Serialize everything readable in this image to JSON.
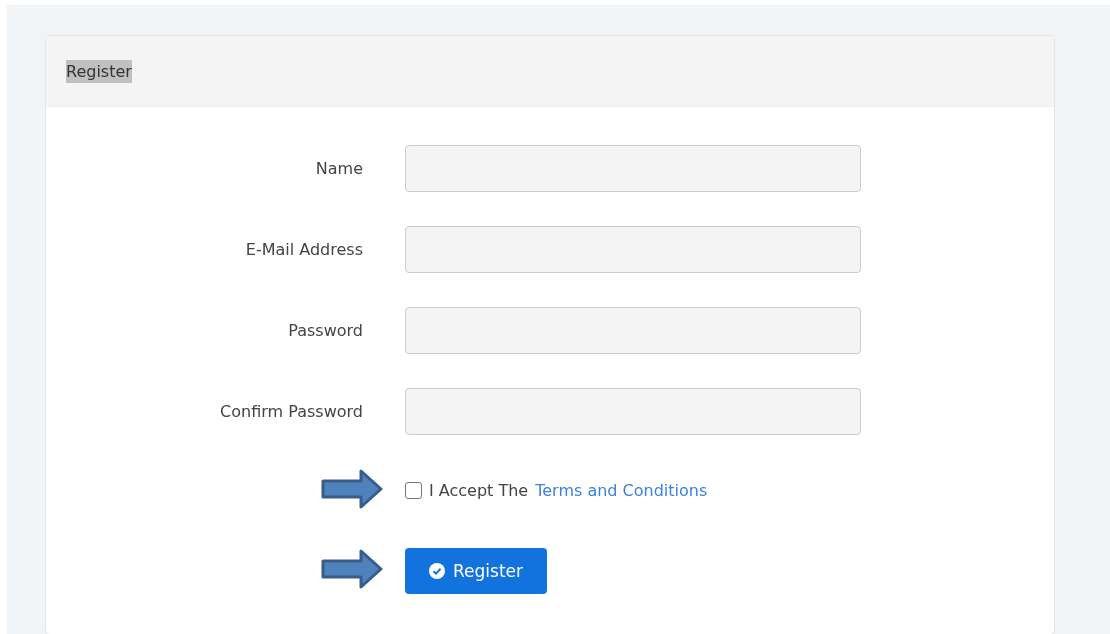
{
  "card": {
    "title": "Register",
    "title_highlighted": true
  },
  "fields": [
    {
      "label": "Name"
    },
    {
      "label": "E-Mail Address"
    },
    {
      "label": "Password"
    },
    {
      "label": "Confirm Password"
    }
  ],
  "terms": {
    "checked": false,
    "text": "I Accept The",
    "link": "Terms and Conditions"
  },
  "submit": {
    "label": "Register"
  }
}
